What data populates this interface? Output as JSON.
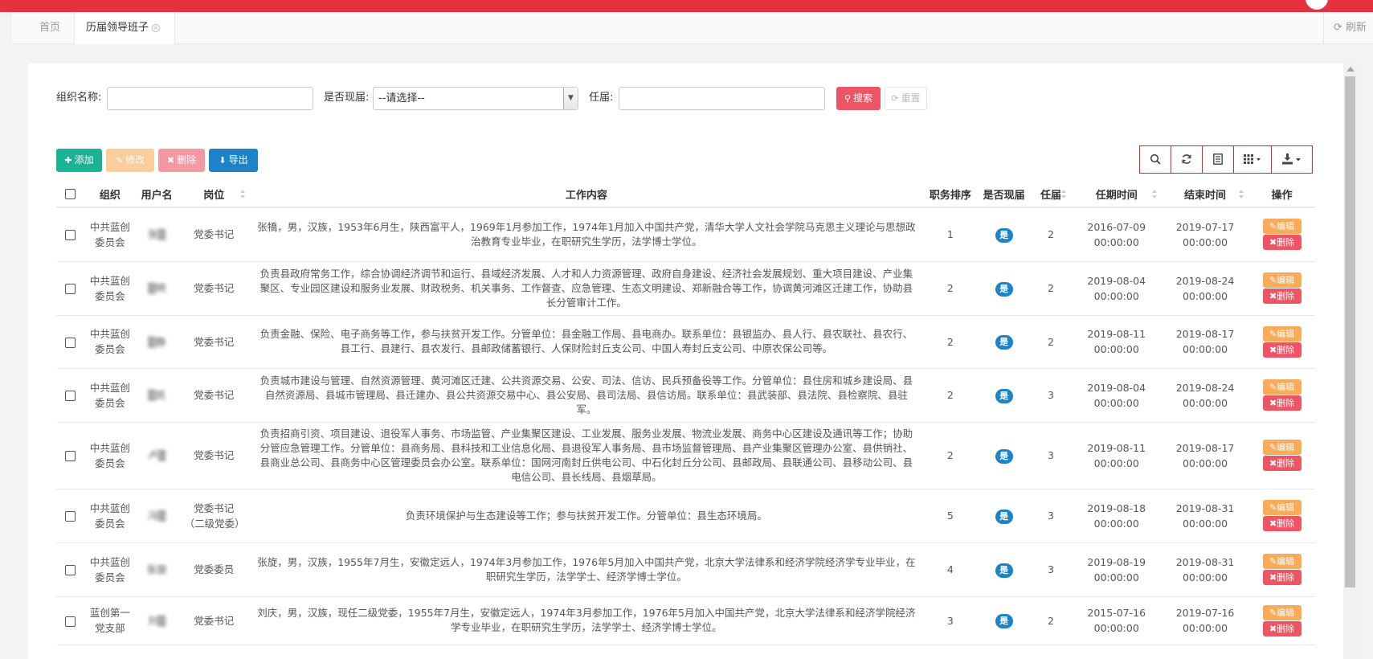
{
  "tabs": {
    "home": "首页",
    "active": "历届领导班子",
    "refresh": "刷新"
  },
  "search": {
    "org_label": "组织名称:",
    "current_label": "是否现届:",
    "current_selected": "--请选择--",
    "term_label": "任届:",
    "search_btn": "搜索",
    "reset_btn": "重置"
  },
  "toolbar": {
    "add": "添加",
    "edit": "修改",
    "delete": "删除",
    "export": "导出"
  },
  "columns": [
    "组织",
    "用户名",
    "岗位",
    "工作内容",
    "职务排序",
    "是否现届",
    "任届",
    "任期时间",
    "结束时间",
    "操作"
  ],
  "row_actions": {
    "edit": "编辑",
    "delete": "删除"
  },
  "rows": [
    {
      "org": "中共蓝创委员会",
      "user": "张▒",
      "post": "党委书记",
      "work": "张犞，男，汉族，1953年6月生，陕西富平人，1969年1月参加工作，1974年1月加入中国共产党，清华大学人文社会学院马克思主义理论与思想政治教育专业毕业，在职研究生学历，法学博士学位。",
      "rank": "1",
      "current": "是",
      "term": "2",
      "start": "2016-07-09 00:00:00",
      "end": "2019-07-17 00:00:00"
    },
    {
      "org": "中共蓝创委员会",
      "user": "▒明",
      "post": "党委书记",
      "work": "负责县政府常务工作，综合协调经济调节和运行、县域经济发展、人才和人力资源管理、政府自身建设、经济社会发展规划、重大项目建设、产业集聚区、专业园区建设和服务业发展、财政税务、机关事务、工作督查、应急管理、生态文明建设、郑新融合等工作，协调黄河滩区迁建工作，协助县长分管审计工作。",
      "rank": "2",
      "current": "是",
      "term": "2",
      "start": "2019-08-04 00:00:00",
      "end": "2019-08-24 00:00:00"
    },
    {
      "org": "中共蓝创委员会",
      "user": "▒静",
      "post": "党委书记",
      "work": "负责金融、保险、电子商务等工作，参与扶贫开发工作。分管单位：县金融工作局、县电商办。联系单位：县银监办、县人行、县农联社、县农行、县工行、县建行、县农发行、县邮政储蓄银行、人保财险封丘支公司、中国人寿封丘支公司、中原农保公司等。",
      "rank": "2",
      "current": "是",
      "term": "2",
      "start": "2019-08-11 00:00:00",
      "end": "2019-08-17 00:00:00"
    },
    {
      "org": "中共蓝创委员会",
      "user": "▒凯",
      "post": "党委书记",
      "work": "负责城市建设与管理、自然资源管理、黄河滩区迁建、公共资源交易、公安、司法、信访、民兵预备役等工作。分管单位：县住房和城乡建设局、县自然资源局、县城市管理局、县迁建办、县公共资源交易中心、县公安局、县司法局、县信访局。联系单位：县武装部、县法院、县检察院、县驻军。",
      "rank": "2",
      "current": "是",
      "term": "3",
      "start": "2019-08-04 00:00:00",
      "end": "2019-08-24 00:00:00"
    },
    {
      "org": "中共蓝创委员会",
      "user": "卢▒",
      "post": "党委书记",
      "work": "负责招商引资、项目建设、退役军人事务、市场监管、产业集聚区建设、工业发展、服务业发展、物流业发展、商务中心区建设及通讯等工作；协助分管应急管理工作。分管单位：县商务局、县科技和工业信息化局、县退役军人事务局、县市场监督管理局、县产业集聚区管理办公室、县供销社、县商业总公司、县商务中心区管理委员会办公室。联系单位：国网河南封丘供电公司、中石化封丘分公司、县邮政局、县联通公司、县移动公司、县电信公司、县长线局、县烟草局。",
      "rank": "2",
      "current": "是",
      "term": "3",
      "start": "2019-08-11 00:00:00",
      "end": "2019-08-17 00:00:00"
    },
    {
      "org": "中共蓝创委员会",
      "user": "冯▒",
      "post": "党委书记（二级党委）",
      "work": "负责环境保护与生态建设等工作；参与扶贫开发工作。分管单位：县生态环境局。",
      "rank": "5",
      "current": "是",
      "term": "3",
      "start": "2019-08-18 00:00:00",
      "end": "2019-08-31 00:00:00"
    },
    {
      "org": "中共蓝创委员会",
      "user": "张旋",
      "post": "党委委员",
      "work": "张旋，男，汉族，1955年7月生，安徽定远人，1974年3月参加工作，1976年5月加入中国共产党，北京大学法律系和经济学院经济学专业毕业，在职研究生学历，法学学士、经济学博士学位。",
      "rank": "4",
      "current": "是",
      "term": "3",
      "start": "2019-08-19 00:00:00",
      "end": "2019-08-31 00:00:00"
    },
    {
      "org": "蓝创第一党支部",
      "user": "刘▒",
      "post": "党委书记",
      "work": "刘庆，男，汉族，现任二级党委，1955年7月生，安徽定远人，1974年3月参加工作，1976年5月加入中国共产党，北京大学法律系和经济学院经济学专业毕业，在职研究生学历，法学学士、经济学博士学位。",
      "rank": "3",
      "current": "是",
      "term": "2",
      "start": "2015-07-16 00:00:00",
      "end": "2019-07-16 00:00:00"
    }
  ]
}
